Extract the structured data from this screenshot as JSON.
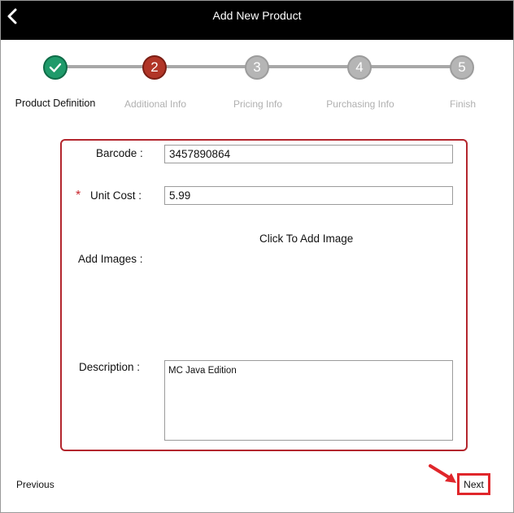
{
  "header": {
    "title": "Add New Product",
    "back_icon": "chevron-left-icon"
  },
  "stepper": {
    "steps": [
      {
        "number": "1",
        "label": "Product Definition",
        "state": "done"
      },
      {
        "number": "2",
        "label": "Additional Info",
        "state": "current"
      },
      {
        "number": "3",
        "label": "Pricing Info",
        "state": "todo"
      },
      {
        "number": "4",
        "label": "Purchasing Info",
        "state": "todo"
      },
      {
        "number": "5",
        "label": "Finish",
        "state": "todo"
      }
    ],
    "done_icon": "checkmark-icon"
  },
  "form": {
    "barcode": {
      "label": "Barcode :",
      "value": "3457890864"
    },
    "unit_cost": {
      "label": "Unit Cost :",
      "value": "5.99",
      "required_mark": "*"
    },
    "images": {
      "label": "Add Images :",
      "link": "Click To Add Image"
    },
    "description": {
      "label": "Description :",
      "value": "MC Java Edition"
    }
  },
  "footer": {
    "previous_label": "Previous",
    "next_label": "Next"
  },
  "colors": {
    "header_bg": "#000000",
    "step_done": "#1f9a6a",
    "step_current": "#b13527",
    "step_todo": "#b5b5b5",
    "card_border": "#b3262d",
    "highlight": "#e0262b"
  }
}
